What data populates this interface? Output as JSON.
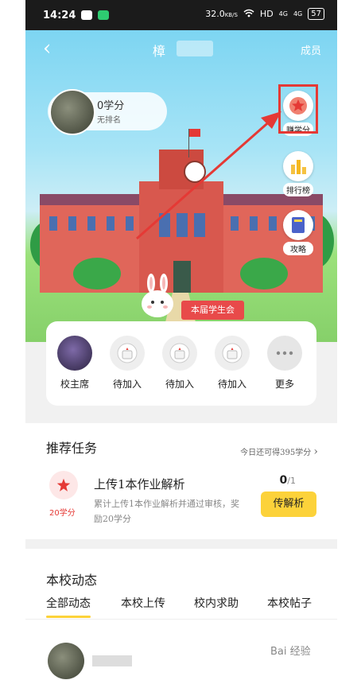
{
  "status": {
    "time": "14:24",
    "speed": "32.0",
    "speed_unit": "KB/S",
    "net": "HD",
    "signal1": "4G",
    "signal2": "4G",
    "battery": "57"
  },
  "nav": {
    "back_icon": "‹",
    "title": "樟",
    "members": "成员"
  },
  "profile": {
    "score": "0学分",
    "rank": "无排名"
  },
  "side": {
    "earn": "赚学分",
    "leaderboard": "排行榜",
    "guide": "攻略"
  },
  "banner": "本届学生会",
  "members": [
    {
      "label": "校主席"
    },
    {
      "label": "待加入"
    },
    {
      "label": "待加入"
    },
    {
      "label": "待加入"
    },
    {
      "label": "更多"
    }
  ],
  "tasks": {
    "title": "推荐任务",
    "today": "今日还可得395学分",
    "chevron": "›",
    "item": {
      "points": "20学分",
      "title": "上传1本作业解析",
      "desc": "累计上传1本作业解析并通过审核，奖励20学分",
      "progress_done": "0",
      "progress_total": "/1",
      "button": "传解析"
    }
  },
  "news": {
    "title": "本校动态",
    "tabs": [
      "全部动态",
      "本校上传",
      "校内求助",
      "本校帖子"
    ],
    "watermark": "Bai 经验"
  },
  "colors": {
    "accent": "#fcd23a",
    "red": "#e53935",
    "sky": "#7dd5f2"
  }
}
